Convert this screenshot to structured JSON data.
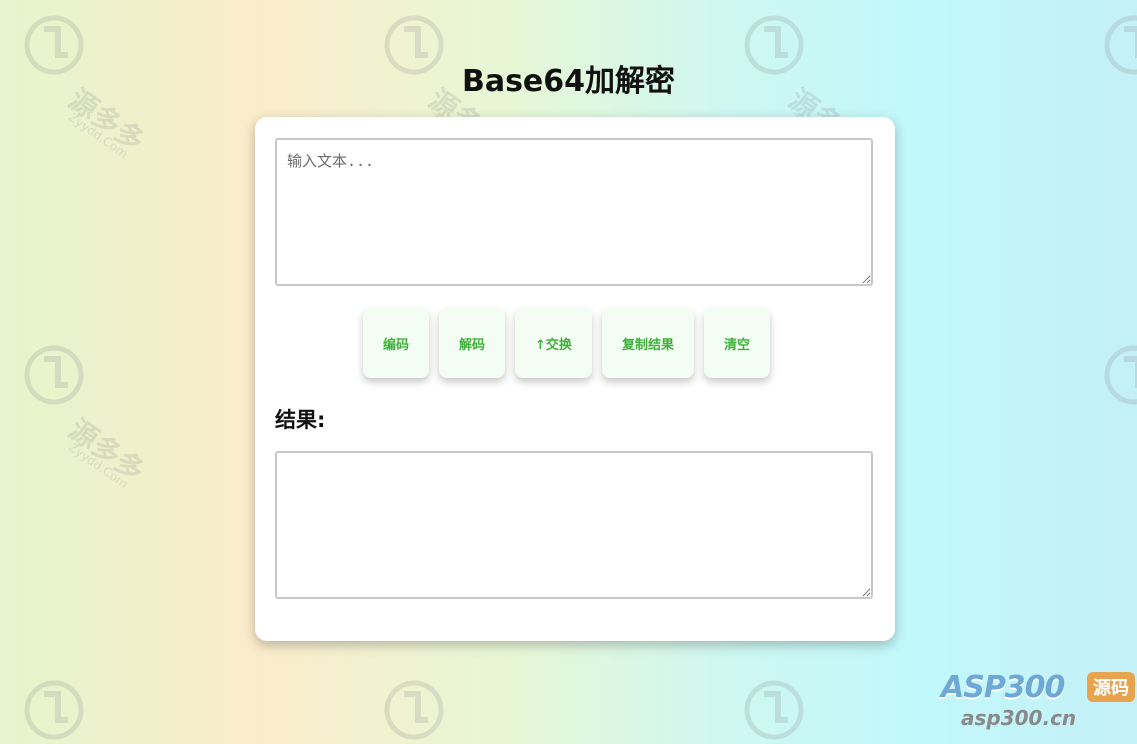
{
  "header": {
    "title": "Base64加解密"
  },
  "input": {
    "placeholder": "输入文本...",
    "value": ""
  },
  "buttons": {
    "encode": "编码",
    "decode": "解码",
    "swap": "↑交换",
    "copy": "复制结果",
    "clear": "清空"
  },
  "result": {
    "label": "结果:",
    "value": ""
  },
  "watermark": {
    "text": "源多多",
    "sub": "Zyydd.Com"
  },
  "brand": {
    "main": "ASP300",
    "badge": "源码",
    "sub": "asp300.cn"
  },
  "colors": {
    "button_text": "#3fb13a",
    "button_bg": "#f4fdf4"
  }
}
